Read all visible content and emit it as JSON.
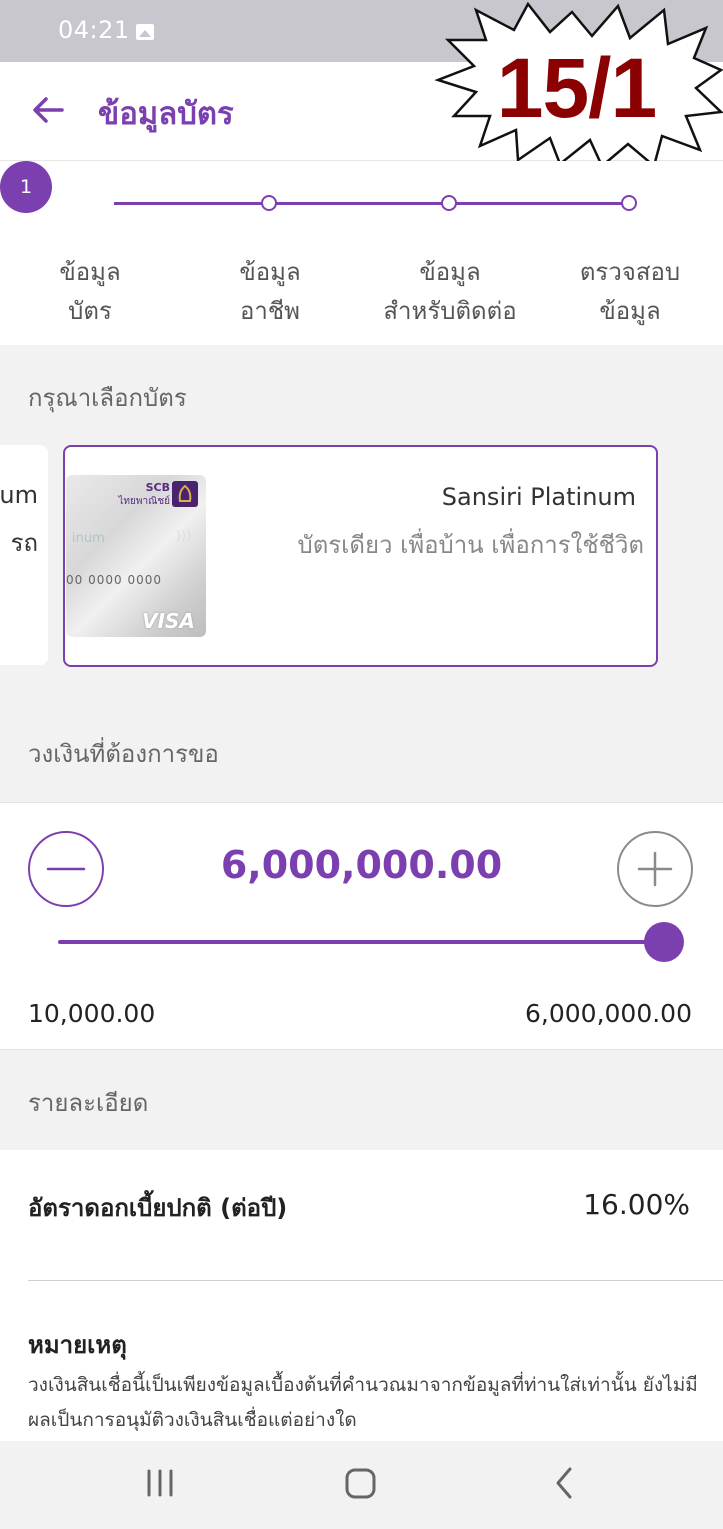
{
  "status_bar": {
    "time": "04:21"
  },
  "header": {
    "title": "ข้อมูลบัตร"
  },
  "badge": {
    "text": "15/1"
  },
  "stepper": {
    "current": "1",
    "steps": [
      {
        "line1": "ข้อมูล",
        "line2": "บัตร"
      },
      {
        "line1": "ข้อมูล",
        "line2": "อาชีพ"
      },
      {
        "line1": "ข้อมูล",
        "line2": "สำหรับติดต่อ"
      },
      {
        "line1": "ตรวจสอบ",
        "line2": "ข้อมูล"
      }
    ]
  },
  "card_section": {
    "label": "กรุณาเลือกบัตร",
    "prev_card": {
      "line1": "um",
      "line2": "รถ"
    },
    "selected_card": {
      "brand": "SCB",
      "bank_name": "ไทยพาณิชย์",
      "card_partial": "inum",
      "card_number": "00 0000 0000",
      "network": "VISA",
      "title": "Sansiri Platinum",
      "subtitle": "บัตรเดียว เพื่อบ้าน เพื่อการใช้ชีวิต"
    }
  },
  "amount": {
    "label": "วงเงินที่ต้องการขอ",
    "value": "6,000,000.00",
    "min": "10,000.00",
    "max": "6,000,000.00",
    "slider_fraction": 1.0
  },
  "details": {
    "label": "รายละเอียด",
    "rate_label": "อัตราดอกเบี้ยปกติ (ต่อปี)",
    "rate_value": "16.00%",
    "note_title": "หมายเหตุ",
    "note_text": "วงเงินสินเชื่อนี้เป็นเพียงข้อมูลเบื้องต้นที่คำนวณมาจากข้อมูลที่ท่านใส่เท่านั้น ยังไม่มีผลเป็นการอนุมัติวงเงินสินเชื่อแต่อย่างใด"
  },
  "theme": {
    "accent": "#7b3fb0",
    "badge_text": "#8b0000"
  },
  "nav_bar": {
    "icons": [
      "recent-apps-icon",
      "home-icon",
      "back-icon"
    ]
  }
}
